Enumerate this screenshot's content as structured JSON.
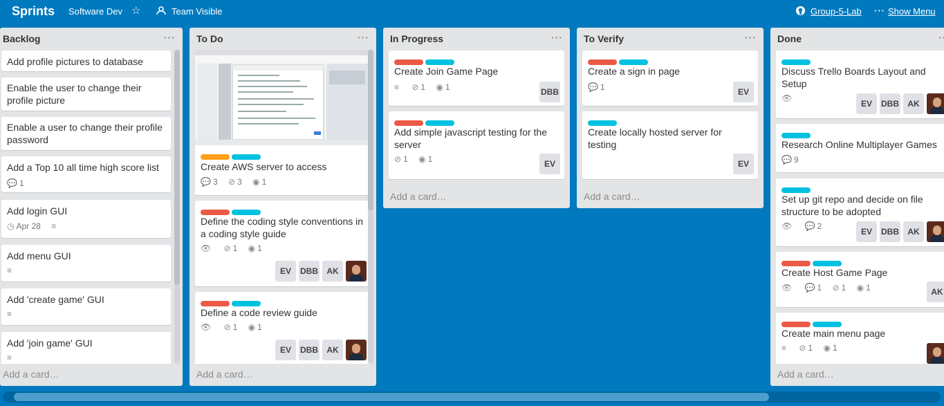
{
  "header": {
    "board_title": "Sprints",
    "team": "Software Dev",
    "star_icon": "star-icon",
    "visibility": "Team Visible",
    "github_repo": "Group-5-Lab",
    "menu_label": "Show Menu"
  },
  "colors": {
    "board_bg": "#0079bf",
    "teal": "#00c2e0",
    "red": "#eb5a46",
    "orange": "#ff9f1a"
  },
  "add_card_label": "Add a card…",
  "lists": [
    {
      "title": "Backlog",
      "cards": [
        {
          "title": "Add profile pictures to database"
        },
        {
          "title": "Enable the user to change their profile picture"
        },
        {
          "title": "Enable a user to change their profile password"
        },
        {
          "title": "Add a Top 10 all time high score list",
          "comments": "1"
        },
        {
          "title": "Add login GUI",
          "due": "Apr 28"
        },
        {
          "title": "Add menu GUI"
        },
        {
          "title": "Add 'create game' GUI"
        },
        {
          "title": "Add 'join game' GUI"
        }
      ]
    },
    {
      "title": "To Do",
      "cards": [
        {
          "title": "Create AWS server to access",
          "comments": "3",
          "attachments": "3",
          "github": "1"
        },
        {
          "title": "Define the coding style conventions in a coding style guide",
          "attachments": "1",
          "github": "1",
          "members": [
            "EV",
            "DBB",
            "AK"
          ]
        },
        {
          "title": "Define a code review guide",
          "attachments": "1",
          "github": "1",
          "members": [
            "EV",
            "DBB",
            "AK"
          ]
        }
      ]
    },
    {
      "title": "In Progress",
      "cards": [
        {
          "title": "Create Join Game Page",
          "attachments": "1",
          "github": "1",
          "members": [
            "DBB"
          ]
        },
        {
          "title": "Add simple javascript testing for the server",
          "attachments": "1",
          "github": "1",
          "members": [
            "EV"
          ]
        }
      ]
    },
    {
      "title": "To Verify",
      "cards": [
        {
          "title": "Create a sign in page",
          "comments": "1",
          "members": [
            "EV"
          ]
        },
        {
          "title": "Create locally hosted server for testing",
          "members": [
            "EV"
          ]
        }
      ]
    },
    {
      "title": "Done",
      "cards": [
        {
          "title": "Discuss Trello Boards Layout and Setup",
          "members": [
            "EV",
            "DBB",
            "AK"
          ]
        },
        {
          "title": "Research Online Multiplayer Games",
          "comments": "9"
        },
        {
          "title": "Set up git repo and decide on file structure to be adopted",
          "comments": "2",
          "members": [
            "EV",
            "DBB",
            "AK"
          ]
        },
        {
          "title": "Create Host Game Page",
          "comments": "1",
          "attachments": "1",
          "github": "1",
          "members": [
            "AK"
          ]
        },
        {
          "title": "Create main menu page",
          "attachments": "1",
          "github": "1"
        }
      ]
    }
  ]
}
